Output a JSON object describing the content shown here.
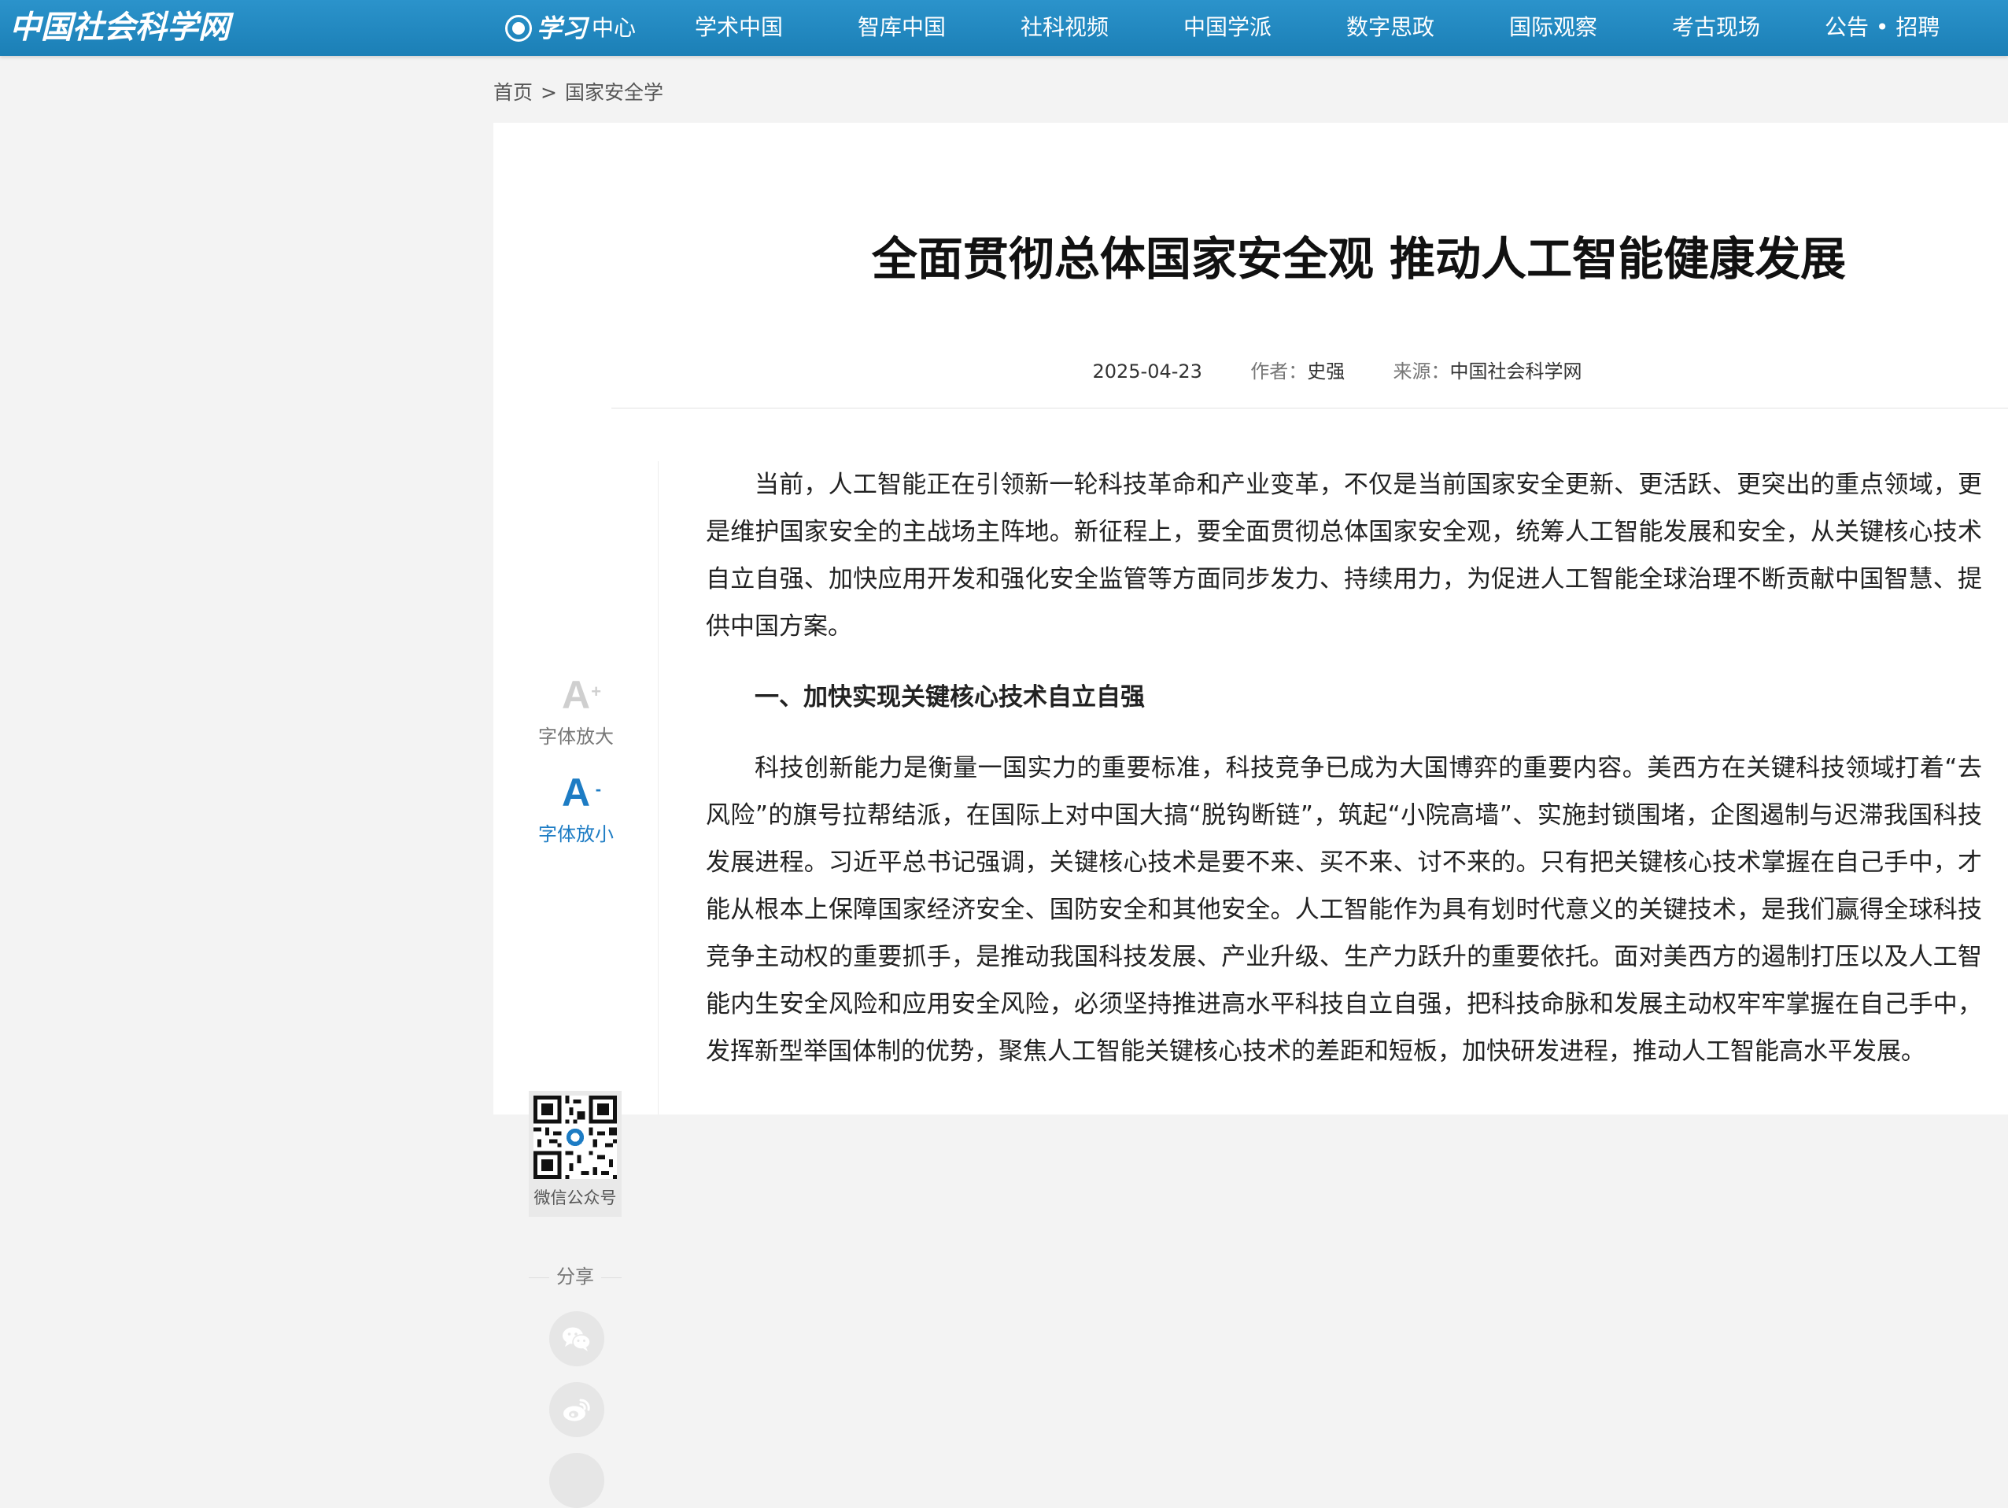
{
  "site": {
    "logo_text": "中国社会科学网"
  },
  "nav": {
    "items": [
      {
        "prefix": "学习",
        "label": "中心"
      },
      {
        "label": "学术中国"
      },
      {
        "label": "智库中国"
      },
      {
        "label": "社科视频"
      },
      {
        "label": "中国学派"
      },
      {
        "label": "数字思政"
      },
      {
        "label": "国际观察"
      },
      {
        "label": "考古现场"
      },
      {
        "label": "公告 • 招聘"
      }
    ]
  },
  "breadcrumb": {
    "home": "首页",
    "separator": ">",
    "current": "国家安全学"
  },
  "article": {
    "title": "全面贯彻总体国家安全观 推动人工智能健康发展",
    "date": "2025-04-23",
    "author_label": "作者：",
    "author": "史强",
    "source_label": "来源：",
    "source": "中国社会科学网",
    "paragraphs": [
      "当前，人工智能正在引领新一轮科技革命和产业变革，不仅是当前国家安全更新、更活跃、更突出的重点领域，更是维护国家安全的主战场主阵地。新征程上，要全面贯彻总体国家安全观，统筹人工智能发展和安全，从关键核心技术自立自强、加快应用开发和强化安全监管等方面同步发力、持续用力，为促进人工智能全球治理不断贡献中国智慧、提供中国方案。",
      "科技创新能力是衡量一国实力的重要标准，科技竞争已成为大国博弈的重要内容。美西方在关键科技领域打着“去风险”的旗号拉帮结派，在国际上对中国大搞“脱钩断链”，筑起“小院高墙”、实施封锁围堵，企图遏制与迟滞我国科技发展进程。习近平总书记强调，关键核心技术是要不来、买不来、讨不来的。只有把关键核心技术掌握在自己手中，才能从根本上保障国家经济安全、国防安全和其他安全。人工智能作为具有划时代意义的关键技术，是我们赢得全球科技竞争主动权的重要抓手，是推动我国科技发展、产业升级、生产力跃升的重要依托。面对美西方的遏制打压以及人工智能内生安全风险和应用安全风险，必须坚持推进高水平科技自立自强，把科技命脉和发展主动权牢牢掌握在自己手中，发挥新型举国体制的优势，聚焦人工智能关键核心技术的差距和短板，加快研发进程，推动人工智能高水平发展。"
    ],
    "section_heading": "一、加快实现关键核心技术自立自强"
  },
  "tools": {
    "font_larger_glyph": "A",
    "font_larger_sup": "+",
    "font_larger": "字体放大",
    "font_smaller_glyph": "A",
    "font_smaller_sup": "-",
    "font_smaller": "字体放小",
    "qr_label": "微信公众号",
    "share_label": "分享"
  },
  "colors": {
    "nav_bg": "#1f86bf",
    "accent": "#1d7cc4"
  }
}
